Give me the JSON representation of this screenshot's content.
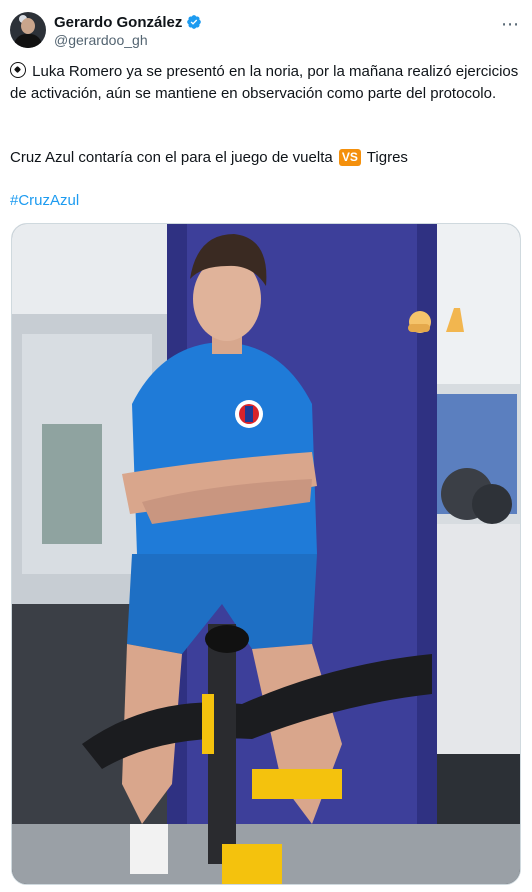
{
  "author": {
    "display_name": "Gerardo González",
    "handle": "@gerardoo_gh",
    "verified": true
  },
  "more_icon": "⋯",
  "post": {
    "line1": "Luka Romero ya se presentó en la noria, por la mañana realizó ejercicios de activación, aún se mantiene en observación como parte del protocolo.",
    "line2_before": "Cruz Azul contaría con el para el juego de vuelta ",
    "vs_label": "VS",
    "line2_after": " Tigres",
    "hashtag": "#CruzAzul"
  },
  "icons": {
    "leading": "soccer-ball-icon",
    "vs": "vs-badge-icon",
    "verified": "verified-badge-icon",
    "overlay": [
      "flexed-biceps-emoji",
      "folded-hands-emoji"
    ]
  },
  "colors": {
    "link": "#1d9bf0",
    "verified": "#1d9bf0",
    "secondary_text": "#536471",
    "vs_badge": "#f4900c"
  }
}
